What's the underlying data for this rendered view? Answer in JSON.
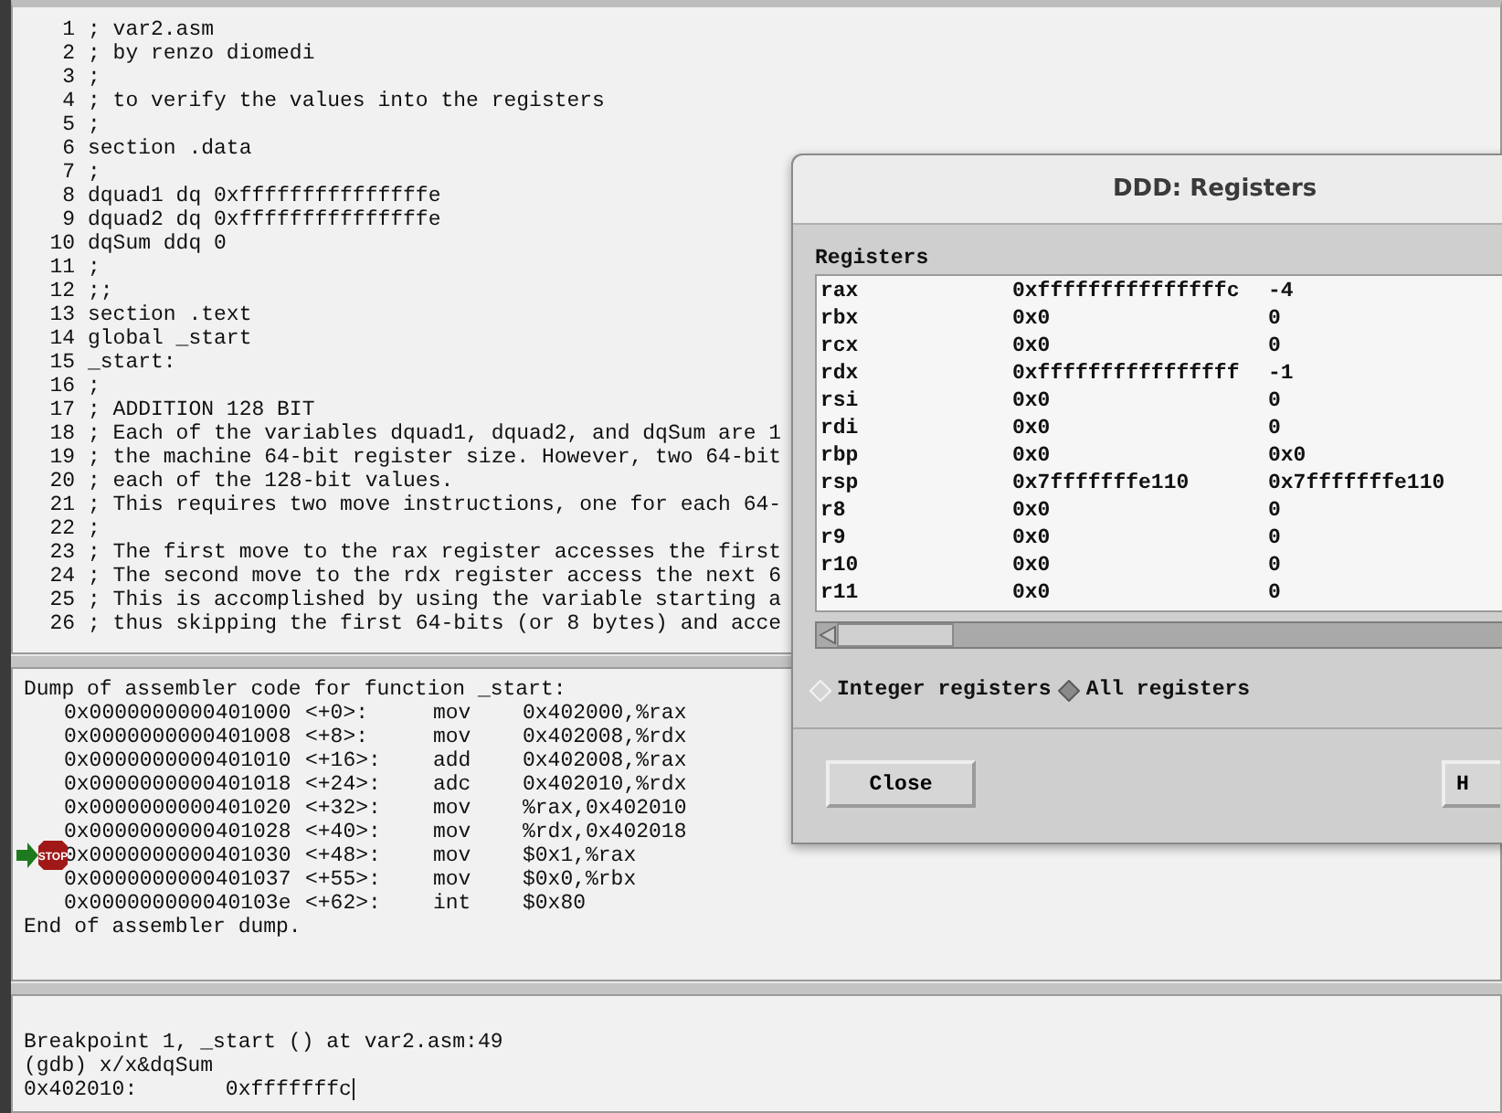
{
  "source": {
    "lines": [
      {
        "number": "1",
        "text": "; var2.asm"
      },
      {
        "number": "2",
        "text": "; by renzo diomedi"
      },
      {
        "number": "3",
        "text": ";"
      },
      {
        "number": "4",
        "text": "; to verify the values into the registers"
      },
      {
        "number": "5",
        "text": ";"
      },
      {
        "number": "6",
        "text": "section .data"
      },
      {
        "number": "7",
        "text": ";"
      },
      {
        "number": "8",
        "text": "dquad1 dq 0xfffffffffffffffe"
      },
      {
        "number": "9",
        "text": "dquad2 dq 0xfffffffffffffffe"
      },
      {
        "number": "10",
        "text": "dqSum ddq 0"
      },
      {
        "number": "11",
        "text": ";"
      },
      {
        "number": "12",
        "text": ";;"
      },
      {
        "number": "13",
        "text": "section .text"
      },
      {
        "number": "14",
        "text": "global _start"
      },
      {
        "number": "15",
        "text": "_start:"
      },
      {
        "number": "16",
        "text": ";"
      },
      {
        "number": "17",
        "text": "; ADDITION 128 BIT"
      },
      {
        "number": "18",
        "text": "; Each of the variables dquad1, dquad2, and dqSum are 1"
      },
      {
        "number": "19",
        "text": "; the machine 64-bit register size. However, two 64-bit"
      },
      {
        "number": "20",
        "text": "; each of the 128-bit values."
      },
      {
        "number": "21",
        "text": "; This requires two move instructions, one for each 64-"
      },
      {
        "number": "22",
        "text": ";"
      },
      {
        "number": "23",
        "text": "; The first move to the rax register accesses the first"
      },
      {
        "number": "24",
        "text": "; The second move to the rdx register access the next 6"
      },
      {
        "number": "25",
        "text": "; This is accomplished by using the variable starting a"
      },
      {
        "number": "26",
        "text": "; thus skipping the first 64-bits (or 8 bytes) and acce"
      }
    ]
  },
  "assembler": {
    "header": "Dump of assembler code for function _start:",
    "rows": [
      {
        "address": "0x0000000000401000",
        "offset": "<+0>:",
        "mnemonic": "mov",
        "operands": "0x402000,%rax",
        "breakpoint": false
      },
      {
        "address": "0x0000000000401008",
        "offset": "<+8>:",
        "mnemonic": "mov",
        "operands": "0x402008,%rdx",
        "breakpoint": false
      },
      {
        "address": "0x0000000000401010",
        "offset": "<+16>:",
        "mnemonic": "add",
        "operands": "0x402008,%rax",
        "breakpoint": false
      },
      {
        "address": "0x0000000000401018",
        "offset": "<+24>:",
        "mnemonic": "adc",
        "operands": "0x402010,%rdx",
        "breakpoint": false
      },
      {
        "address": "0x0000000000401020",
        "offset": "<+32>:",
        "mnemonic": "mov",
        "operands": "%rax,0x402010",
        "breakpoint": false
      },
      {
        "address": "0x0000000000401028",
        "offset": "<+40>:",
        "mnemonic": "mov",
        "operands": "%rdx,0x402018",
        "breakpoint": false
      },
      {
        "address": "0x0000000000401030",
        "offset": "<+48>:",
        "mnemonic": "mov",
        "operands": "$0x1,%rax",
        "breakpoint": true
      },
      {
        "address": "0x0000000000401037",
        "offset": "<+55>:",
        "mnemonic": "mov",
        "operands": "$0x0,%rbx",
        "breakpoint": false
      },
      {
        "address": "0x000000000040103e",
        "offset": "<+62>:",
        "mnemonic": "int",
        "operands": "$0x80",
        "breakpoint": false
      }
    ],
    "footer": "End of assembler dump.",
    "stop_label": "STOP"
  },
  "console": {
    "lines": [
      "Breakpoint 1, _start () at var2.asm:49",
      "(gdb) x/x&dqSum",
      "0x402010:\t0xfffffffc"
    ]
  },
  "dialog": {
    "title": "DDD: Registers",
    "list_label": "Registers",
    "registers": [
      {
        "name": "rax",
        "raw": "0xfffffffffffffffc",
        "natural": "-4"
      },
      {
        "name": "rbx",
        "raw": "0x0",
        "natural": "0"
      },
      {
        "name": "rcx",
        "raw": "0x0",
        "natural": "0"
      },
      {
        "name": "rdx",
        "raw": "0xffffffffffffffff",
        "natural": "-1"
      },
      {
        "name": "rsi",
        "raw": "0x0",
        "natural": "0"
      },
      {
        "name": "rdi",
        "raw": "0x0",
        "natural": "0"
      },
      {
        "name": "rbp",
        "raw": "0x0",
        "natural": "0x0"
      },
      {
        "name": "rsp",
        "raw": "0x7fffffffe110",
        "natural": "0x7fffffffe110"
      },
      {
        "name": "r8",
        "raw": "0x0",
        "natural": "0"
      },
      {
        "name": "r9",
        "raw": "0x0",
        "natural": "0"
      },
      {
        "name": "r10",
        "raw": "0x0",
        "natural": "0"
      },
      {
        "name": "r11",
        "raw": "0x0",
        "natural": "0"
      }
    ],
    "options": [
      {
        "label": "Integer registers",
        "selected": false
      },
      {
        "label": "All registers",
        "selected": true
      }
    ],
    "buttons": [
      "Close",
      "H"
    ]
  }
}
